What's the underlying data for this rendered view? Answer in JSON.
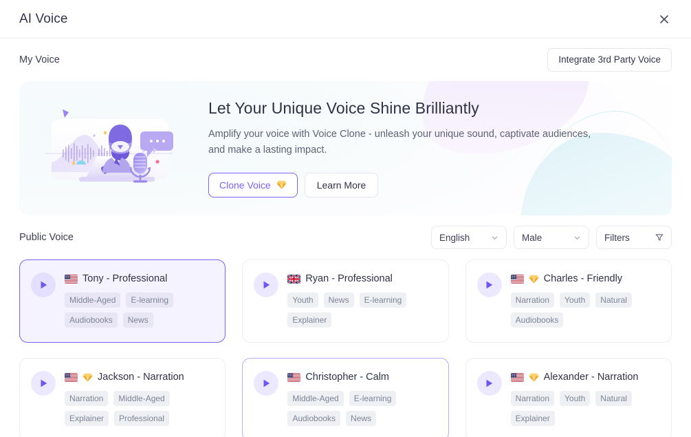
{
  "window": {
    "title": "AI Voice",
    "close_icon": "close-icon"
  },
  "my_voice": {
    "section_label": "My Voice",
    "integrate_button": "Integrate 3rd Party Voice",
    "hero": {
      "title": "Let Your Unique Voice Shine Brilliantly",
      "subtitle": "Amplify your voice with Voice Clone - unleash your unique sound, captivate audiences, and make a lasting impact.",
      "primary_button": "Clone Voice",
      "primary_button_icon": "gem-icon",
      "secondary_button": "Learn More",
      "illustration": "voice-clone-illustration"
    }
  },
  "public_voice": {
    "section_label": "Public Voice",
    "filters": {
      "language": {
        "value": "English",
        "icon": "chevron-down-icon"
      },
      "gender": {
        "value": "Male",
        "icon": "chevron-down-icon"
      },
      "filters": {
        "value": "Filters",
        "icon": "filter-icon"
      }
    },
    "cards": [
      {
        "name": "Tony - Professional",
        "flag": "us",
        "premium": false,
        "selected": true,
        "hovered": false,
        "tags": [
          "Middle-Aged",
          "E-learning",
          "Audiobooks",
          "News"
        ]
      },
      {
        "name": "Ryan - Professional",
        "flag": "uk",
        "premium": false,
        "selected": false,
        "hovered": false,
        "tags": [
          "Youth",
          "News",
          "E-learning",
          "Explainer"
        ]
      },
      {
        "name": "Charles - Friendly",
        "flag": "us",
        "premium": true,
        "selected": false,
        "hovered": false,
        "tags": [
          "Narration",
          "Youth",
          "Natural",
          "Audiobooks"
        ]
      },
      {
        "name": "Jackson - Narration",
        "flag": "us",
        "premium": true,
        "selected": false,
        "hovered": false,
        "tags": [
          "Narration",
          "Middle-Aged",
          "Explainer",
          "Professional"
        ]
      },
      {
        "name": "Christopher - Calm",
        "flag": "us",
        "premium": false,
        "selected": false,
        "hovered": true,
        "tags": [
          "Middle-Aged",
          "E-learning",
          "Audiobooks",
          "News"
        ]
      },
      {
        "name": "Alexander - Narration",
        "flag": "us",
        "premium": true,
        "selected": false,
        "hovered": false,
        "tags": [
          "Narration",
          "Youth",
          "Natural",
          "Explainer"
        ]
      }
    ]
  },
  "colors": {
    "accent": "#7b61ff",
    "accent_soft": "#ece8ff",
    "selected_bg": "#f5f3ff",
    "border": "#eceef2",
    "tag_bg": "#eef0f4",
    "tag_text": "#7e8496",
    "text": "#2f3247",
    "muted": "#5d6275",
    "gem": "#f8b83c"
  }
}
